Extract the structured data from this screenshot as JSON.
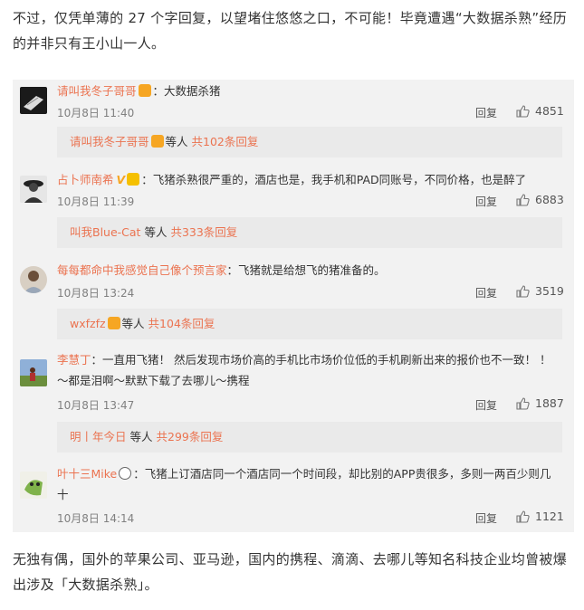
{
  "intro_text": "不过，仅凭单薄的 27 个字回复，以望堵住悠悠之口，不可能！毕竟遭遇“大数据杀熟”经历的并非只有王小山一人。",
  "outro_text": "无独有偶，国外的苹果公司、亚马逊，国内的携程、滴滴、去哪儿等知名科技企业均曾被爆出涉及「大数据杀熟」。",
  "reply_label": "回复",
  "comments": [
    {
      "user": "请叫我冬子哥哥",
      "text": "：大数据杀猪",
      "time": "10月8日 11:40",
      "likes": "4851",
      "sub_user": "请叫我冬子哥哥",
      "sub_suffix": "等人",
      "sub_more": "共102条回复"
    },
    {
      "user": "占卜师南希",
      "vmark": "V",
      "text": "：飞猪杀熟很严重的，酒店也是，我手机和PAD同账号，不同价格，也是醉了",
      "time": "10月8日 11:39",
      "likes": "6883",
      "sub_user": "叫我Blue-Cat",
      "sub_suffix": "等人",
      "sub_more": "共333条回复"
    },
    {
      "user": "每每都命中我感觉自己像个预言家",
      "text": "：飞猪就是给想飞的猪准备的。",
      "time": "10月8日 13:24",
      "likes": "3519",
      "sub_user": "wxfzfz",
      "sub_suffix": "等人",
      "sub_more": "共104条回复"
    },
    {
      "user": "李慧丁",
      "text": "：一直用飞猪！ 然后发现市场价高的手机比市场价位低的手机刷新出来的报价也不一致！ ！",
      "text2": "～都是泪啊～默默下载了去哪儿～携程",
      "time": "10月8日 13:47",
      "likes": "1887",
      "sub_user": "明丨年今日",
      "sub_suffix": "等人",
      "sub_more": "共299条回复"
    },
    {
      "user": "叶十三Mike",
      "text": "：飞猪上订酒店同一个酒店同一个时间段，却比别的APP贵很多，多则一两百少则几",
      "text2": "十",
      "time": "10月8日 14:14",
      "likes": "1121"
    }
  ]
}
